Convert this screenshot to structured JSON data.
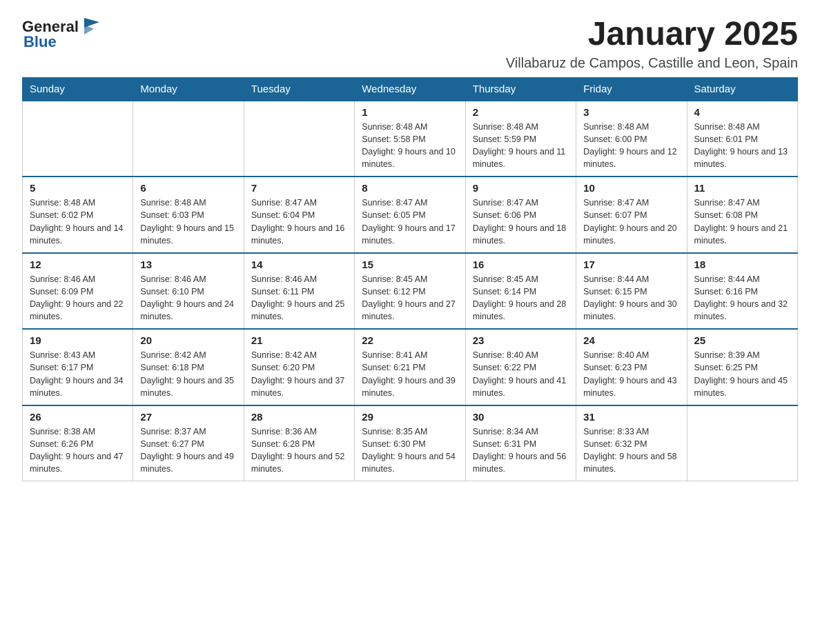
{
  "logo": {
    "text_general": "General",
    "text_blue": "Blue"
  },
  "title": "January 2025",
  "subtitle": "Villabaruz de Campos, Castille and Leon, Spain",
  "days_of_week": [
    "Sunday",
    "Monday",
    "Tuesday",
    "Wednesday",
    "Thursday",
    "Friday",
    "Saturday"
  ],
  "weeks": [
    [
      {
        "day": "",
        "info": ""
      },
      {
        "day": "",
        "info": ""
      },
      {
        "day": "",
        "info": ""
      },
      {
        "day": "1",
        "info": "Sunrise: 8:48 AM\nSunset: 5:58 PM\nDaylight: 9 hours and 10 minutes."
      },
      {
        "day": "2",
        "info": "Sunrise: 8:48 AM\nSunset: 5:59 PM\nDaylight: 9 hours and 11 minutes."
      },
      {
        "day": "3",
        "info": "Sunrise: 8:48 AM\nSunset: 6:00 PM\nDaylight: 9 hours and 12 minutes."
      },
      {
        "day": "4",
        "info": "Sunrise: 8:48 AM\nSunset: 6:01 PM\nDaylight: 9 hours and 13 minutes."
      }
    ],
    [
      {
        "day": "5",
        "info": "Sunrise: 8:48 AM\nSunset: 6:02 PM\nDaylight: 9 hours and 14 minutes."
      },
      {
        "day": "6",
        "info": "Sunrise: 8:48 AM\nSunset: 6:03 PM\nDaylight: 9 hours and 15 minutes."
      },
      {
        "day": "7",
        "info": "Sunrise: 8:47 AM\nSunset: 6:04 PM\nDaylight: 9 hours and 16 minutes."
      },
      {
        "day": "8",
        "info": "Sunrise: 8:47 AM\nSunset: 6:05 PM\nDaylight: 9 hours and 17 minutes."
      },
      {
        "day": "9",
        "info": "Sunrise: 8:47 AM\nSunset: 6:06 PM\nDaylight: 9 hours and 18 minutes."
      },
      {
        "day": "10",
        "info": "Sunrise: 8:47 AM\nSunset: 6:07 PM\nDaylight: 9 hours and 20 minutes."
      },
      {
        "day": "11",
        "info": "Sunrise: 8:47 AM\nSunset: 6:08 PM\nDaylight: 9 hours and 21 minutes."
      }
    ],
    [
      {
        "day": "12",
        "info": "Sunrise: 8:46 AM\nSunset: 6:09 PM\nDaylight: 9 hours and 22 minutes."
      },
      {
        "day": "13",
        "info": "Sunrise: 8:46 AM\nSunset: 6:10 PM\nDaylight: 9 hours and 24 minutes."
      },
      {
        "day": "14",
        "info": "Sunrise: 8:46 AM\nSunset: 6:11 PM\nDaylight: 9 hours and 25 minutes."
      },
      {
        "day": "15",
        "info": "Sunrise: 8:45 AM\nSunset: 6:12 PM\nDaylight: 9 hours and 27 minutes."
      },
      {
        "day": "16",
        "info": "Sunrise: 8:45 AM\nSunset: 6:14 PM\nDaylight: 9 hours and 28 minutes."
      },
      {
        "day": "17",
        "info": "Sunrise: 8:44 AM\nSunset: 6:15 PM\nDaylight: 9 hours and 30 minutes."
      },
      {
        "day": "18",
        "info": "Sunrise: 8:44 AM\nSunset: 6:16 PM\nDaylight: 9 hours and 32 minutes."
      }
    ],
    [
      {
        "day": "19",
        "info": "Sunrise: 8:43 AM\nSunset: 6:17 PM\nDaylight: 9 hours and 34 minutes."
      },
      {
        "day": "20",
        "info": "Sunrise: 8:42 AM\nSunset: 6:18 PM\nDaylight: 9 hours and 35 minutes."
      },
      {
        "day": "21",
        "info": "Sunrise: 8:42 AM\nSunset: 6:20 PM\nDaylight: 9 hours and 37 minutes."
      },
      {
        "day": "22",
        "info": "Sunrise: 8:41 AM\nSunset: 6:21 PM\nDaylight: 9 hours and 39 minutes."
      },
      {
        "day": "23",
        "info": "Sunrise: 8:40 AM\nSunset: 6:22 PM\nDaylight: 9 hours and 41 minutes."
      },
      {
        "day": "24",
        "info": "Sunrise: 8:40 AM\nSunset: 6:23 PM\nDaylight: 9 hours and 43 minutes."
      },
      {
        "day": "25",
        "info": "Sunrise: 8:39 AM\nSunset: 6:25 PM\nDaylight: 9 hours and 45 minutes."
      }
    ],
    [
      {
        "day": "26",
        "info": "Sunrise: 8:38 AM\nSunset: 6:26 PM\nDaylight: 9 hours and 47 minutes."
      },
      {
        "day": "27",
        "info": "Sunrise: 8:37 AM\nSunset: 6:27 PM\nDaylight: 9 hours and 49 minutes."
      },
      {
        "day": "28",
        "info": "Sunrise: 8:36 AM\nSunset: 6:28 PM\nDaylight: 9 hours and 52 minutes."
      },
      {
        "day": "29",
        "info": "Sunrise: 8:35 AM\nSunset: 6:30 PM\nDaylight: 9 hours and 54 minutes."
      },
      {
        "day": "30",
        "info": "Sunrise: 8:34 AM\nSunset: 6:31 PM\nDaylight: 9 hours and 56 minutes."
      },
      {
        "day": "31",
        "info": "Sunrise: 8:33 AM\nSunset: 6:32 PM\nDaylight: 9 hours and 58 minutes."
      },
      {
        "day": "",
        "info": ""
      }
    ]
  ]
}
